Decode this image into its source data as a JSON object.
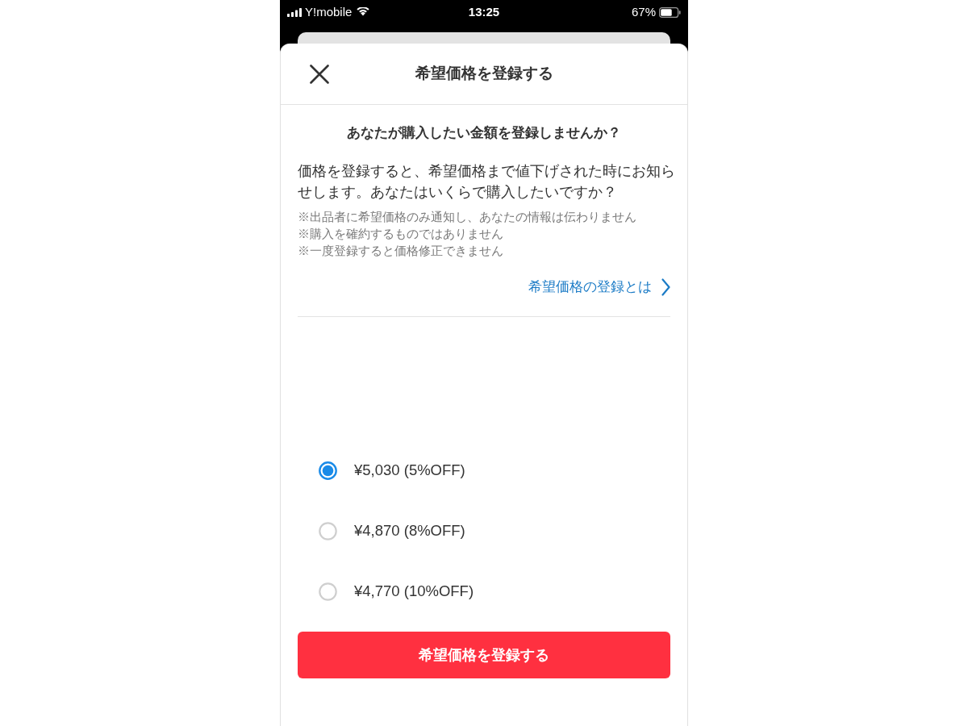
{
  "status_bar": {
    "carrier": "Y!mobile",
    "time": "13:25",
    "battery": "67%"
  },
  "sheet": {
    "title": "希望価格を登録する"
  },
  "prompt": {
    "heading": "あなたが購入したい金額を登録しませんか？",
    "description": "価格を登録すると、希望価格まで値下げされた時にお知らせします。あなたはいくらで購入したいですか？",
    "notes": [
      "※出品者に希望価格のみ通知し、あなたの情報は伝わりません",
      "※購入を確約するものではありません",
      "※一度登録すると価格修正できません"
    ],
    "link": "希望価格の登録とは"
  },
  "price_options": [
    {
      "label": "¥5,030 (5%OFF)",
      "selected": true
    },
    {
      "label": "¥4,870 (8%OFF)",
      "selected": false
    },
    {
      "label": "¥4,770 (10%OFF)",
      "selected": false
    }
  ],
  "submit_button": "希望価格を登録する"
}
